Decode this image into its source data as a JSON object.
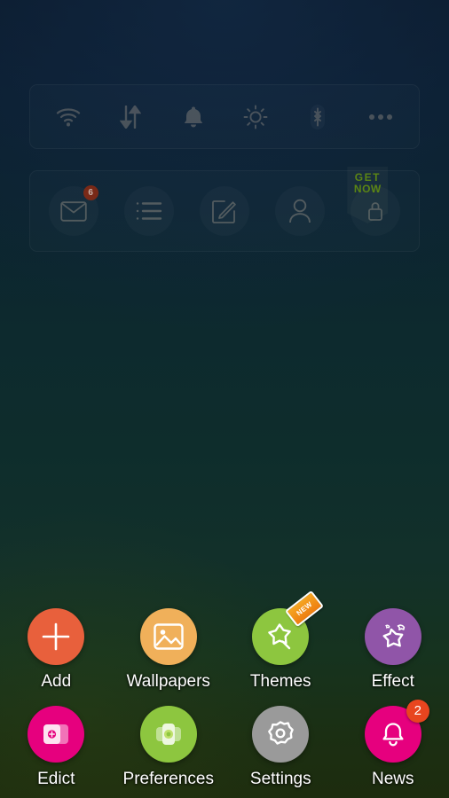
{
  "theme": {
    "bg_top": "#0a1a2c",
    "bg_mid": "#0d2a2e",
    "bg_bottom": "#1d2c0e"
  },
  "toggle_panel": {
    "name": "quick-toggles-widget",
    "items": [
      {
        "icon": "wifi-icon",
        "label": "Wi-Fi"
      },
      {
        "icon": "data-transfer-icon",
        "label": "Mobile data"
      },
      {
        "icon": "bell-icon",
        "label": "Ringer"
      },
      {
        "icon": "brightness-icon",
        "label": "Brightness"
      },
      {
        "icon": "bluetooth-icon",
        "label": "Bluetooth"
      },
      {
        "icon": "more-dots-icon",
        "label": "More"
      }
    ]
  },
  "shortcut_panel": {
    "name": "shortcut-widget",
    "items": [
      {
        "icon": "mail-icon",
        "label": "Mail",
        "badge": "6"
      },
      {
        "icon": "list-icon",
        "label": "List",
        "badge": ""
      },
      {
        "icon": "compose-icon",
        "label": "Compose",
        "badge": ""
      },
      {
        "icon": "contact-icon",
        "label": "Contacts",
        "badge": ""
      },
      {
        "icon": "lock-icon",
        "label": "Locked",
        "badge": ""
      }
    ],
    "promo": {
      "line1": "GET",
      "line2": "NOW",
      "color": "#5f8a12"
    }
  },
  "app_grid": {
    "apps": [
      {
        "label": "Add",
        "icon": "plus-icon",
        "color": "#e8603c",
        "badge": "",
        "tag": ""
      },
      {
        "label": "Wallpapers",
        "icon": "image-icon",
        "color": "#f0b05a",
        "badge": "",
        "tag": ""
      },
      {
        "label": "Themes",
        "icon": "magic-star-icon",
        "color": "#8dc63f",
        "badge": "",
        "tag": "NEW"
      },
      {
        "label": "Effect",
        "icon": "sparkle-star-icon",
        "color": "#9055a8",
        "badge": "",
        "tag": ""
      },
      {
        "label": "Edict",
        "icon": "cards-plus-icon",
        "color": "#e6007e",
        "badge": "",
        "tag": ""
      },
      {
        "label": "Preferences",
        "icon": "cards-dot-icon",
        "color": "#8dc63f",
        "badge": "",
        "tag": ""
      },
      {
        "label": "Settings",
        "icon": "gear-icon",
        "color": "#9a9a9a",
        "badge": "",
        "tag": ""
      },
      {
        "label": "News",
        "icon": "bell-outline-icon",
        "color": "#e6007e",
        "badge": "2",
        "tag": ""
      }
    ]
  }
}
